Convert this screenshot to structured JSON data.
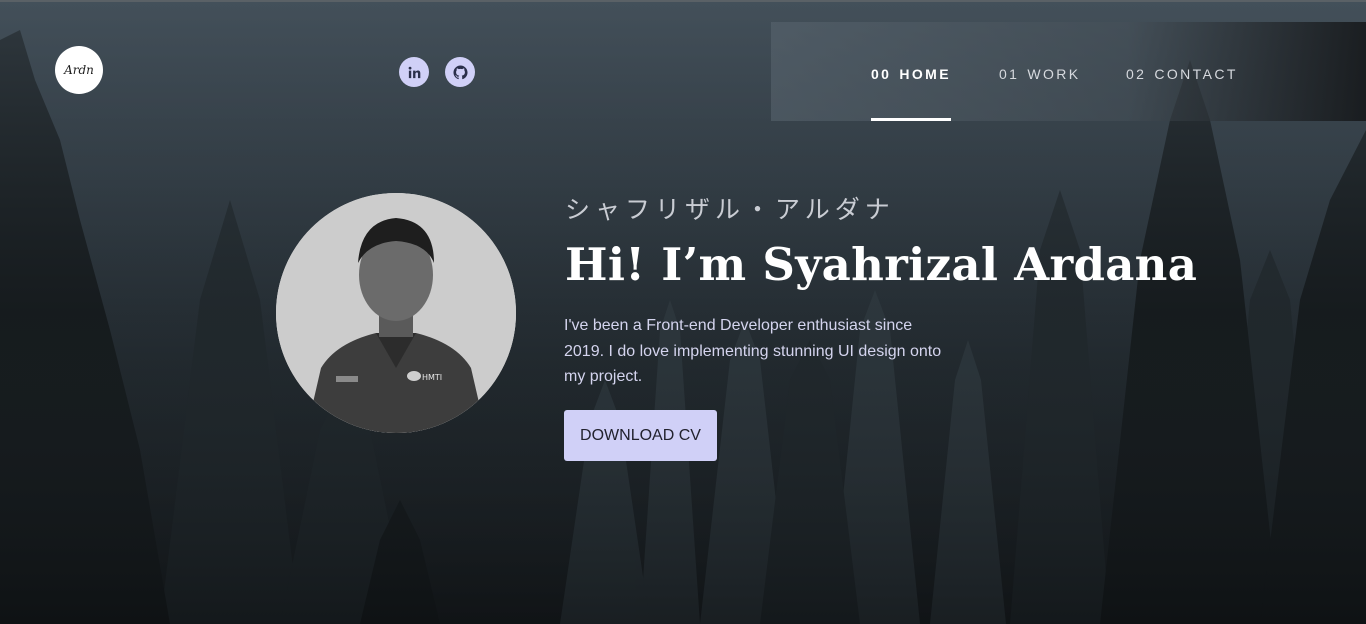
{
  "logo": {
    "text": "Ardn"
  },
  "social": [
    {
      "label": "in",
      "icon": "linkedin-icon"
    },
    {
      "icon": "github-icon"
    }
  ],
  "nav": {
    "items": [
      {
        "num": "00",
        "label": "HOME",
        "active": true
      },
      {
        "num": "01",
        "label": "WORK",
        "active": false
      },
      {
        "num": "02",
        "label": "CONTACT",
        "active": false
      }
    ]
  },
  "hero": {
    "jp_name": "シャフリザル・アルダナ",
    "headline": "Hi! I’m Syahrizal Ardana",
    "bio": "I've been a Front-end Developer enthusiast since 2019. I do love implementing stunning UI design onto my project.",
    "cta_label": "DOWNLOAD CV",
    "badge_text": "HMTI"
  },
  "colors": {
    "accent": "#d0d0f7",
    "text_light": "#d4d4ee",
    "background_top": "#3a4650",
    "background_bottom": "#15191c"
  }
}
